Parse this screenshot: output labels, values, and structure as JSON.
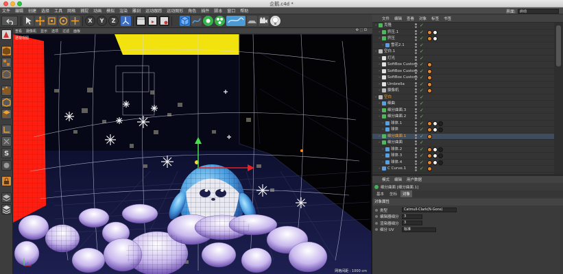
{
  "window": {
    "title": "企鹅.c4d *"
  },
  "menu": [
    "文件",
    "编辑",
    "创建",
    "选择",
    "工具",
    "网格",
    "捕捉",
    "动画",
    "模拟",
    "渲染",
    "雕刻",
    "运动跟踪",
    "运动图形",
    "角色",
    "插件",
    "脚本",
    "窗口",
    "帮助"
  ],
  "interface": {
    "label": "界面:",
    "value": "启动"
  },
  "toolbar": {
    "axis": [
      "X",
      "Y",
      "Z"
    ]
  },
  "viewport": {
    "menu": [
      "查看",
      "摄像机",
      "显示",
      "选项",
      "过滤",
      "面板"
    ],
    "camera_label": "透视视图",
    "grid_label": "网格间距 : 1000 cm",
    "axes": {
      "x": "X",
      "y": "Y",
      "z": "Z"
    }
  },
  "object_manager": {
    "menu": [
      "文件",
      "编辑",
      "查看",
      "对象",
      "标签",
      "书签"
    ],
    "rows": [
      {
        "name": "克隆",
        "indent": 0,
        "icon": "cloner-icon",
        "color": "#4fb85a",
        "tags": 0
      },
      {
        "name": "挤压.1",
        "indent": 1,
        "icon": "extrude-icon",
        "color": "#4fb85a",
        "tags": 2
      },
      {
        "name": "挤压",
        "indent": 1,
        "icon": "extrude-icon",
        "color": "#4fb85a",
        "tags": 2
      },
      {
        "name": "雪花2.1",
        "indent": 2,
        "icon": "spline-icon",
        "color": "#5aa0e0",
        "tags": 0
      },
      {
        "name": "空白.1",
        "indent": 0,
        "icon": "null-icon",
        "color": "#bbbbbb",
        "tags": 0
      },
      {
        "name": "灯光",
        "indent": 1,
        "icon": "light-icon",
        "color": "#e0e0e0",
        "tags": 0
      },
      {
        "name": "SoftBox Custom",
        "indent": 1,
        "icon": "light-icon",
        "color": "#e0e0e0",
        "tags": 1
      },
      {
        "name": "SoftBox Custom",
        "indent": 1,
        "icon": "light-icon",
        "color": "#e0e0e0",
        "tags": 1
      },
      {
        "name": "SoftBox Custom",
        "indent": 1,
        "icon": "light-icon",
        "color": "#e0e0e0",
        "tags": 1
      },
      {
        "name": "Umbrella",
        "indent": 1,
        "icon": "light-icon",
        "color": "#e0e0e0",
        "tags": 1
      },
      {
        "name": "摄像机",
        "indent": 1,
        "icon": "camera-icon",
        "color": "#bbbbbb",
        "tags": 1
      },
      {
        "name": "空白",
        "indent": 0,
        "icon": "null-icon",
        "color": "#bbbbbb",
        "tags": 0,
        "highlight": true
      },
      {
        "name": "细曲",
        "indent": 1,
        "icon": "bend-icon",
        "color": "#5aa0e0",
        "tags": 0
      },
      {
        "name": "细分曲面.3",
        "indent": 1,
        "icon": "subdivision-icon",
        "color": "#4fb85a",
        "tags": 0
      },
      {
        "name": "细分曲面.2",
        "indent": 1,
        "icon": "subdivision-icon",
        "color": "#4fb85a",
        "tags": 0
      },
      {
        "name": "球体.1",
        "indent": 2,
        "icon": "sphere-icon",
        "color": "#5aa0e0",
        "tags": 3
      },
      {
        "name": "球体",
        "indent": 2,
        "icon": "sphere-icon",
        "color": "#5aa0e0",
        "tags": 3
      },
      {
        "name": "细分曲面.1",
        "indent": 1,
        "icon": "subdivision-icon",
        "color": "#4fb85a",
        "tags": 1,
        "highlight": true,
        "selected": true
      },
      {
        "name": "细分曲面",
        "indent": 1,
        "icon": "subdivision-icon",
        "color": "#4fb85a",
        "tags": 0
      },
      {
        "name": "球体.2",
        "indent": 2,
        "icon": "sphere-icon",
        "color": "#5aa0e0",
        "tags": 3
      },
      {
        "name": "球体.3",
        "indent": 2,
        "icon": "sphere-icon",
        "color": "#5aa0e0",
        "tags": 3
      },
      {
        "name": "球体.4",
        "indent": 2,
        "icon": "sphere-icon",
        "color": "#5aa0e0",
        "tags": 3
      },
      {
        "name": "C Curve.1",
        "indent": 1,
        "icon": "curve-icon",
        "color": "#5aa0e0",
        "tags": 1
      }
    ]
  },
  "attributes": {
    "menu": [
      "模式",
      "编辑",
      "用户数据"
    ],
    "object_title": "细分曲面 [细分曲面.1]",
    "tabs": [
      "基本",
      "坐标",
      "对象"
    ],
    "active_tab": 2,
    "section": "对象属性",
    "fields": [
      {
        "label": "类型",
        "value": "Catmull-Clark(N-Gons)",
        "width": 80
      },
      {
        "label": "编辑器细分",
        "value": "3",
        "width": 30
      },
      {
        "label": "渲染器细分",
        "value": "3",
        "width": 30
      },
      {
        "label": "细分 UV",
        "value": "标准",
        "width": 50
      }
    ]
  }
}
